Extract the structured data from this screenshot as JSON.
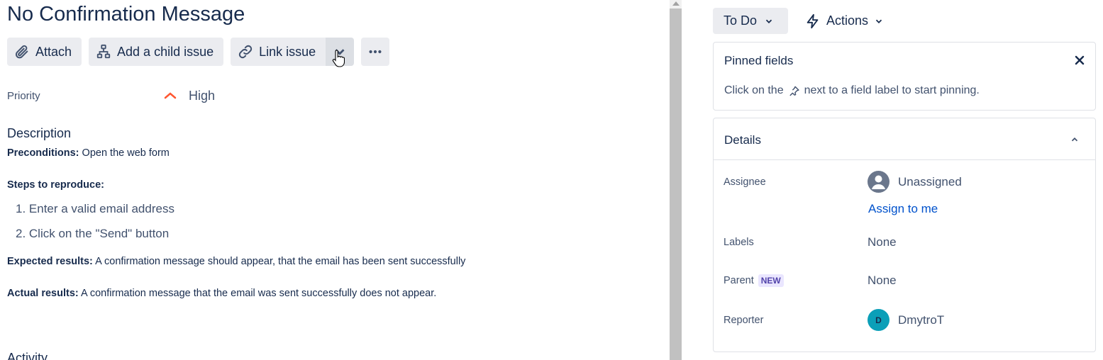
{
  "issue": {
    "title": "No Confirmation Message"
  },
  "toolbar": {
    "attach_label": "Attach",
    "child_label": "Add a child issue",
    "link_label": "Link issue"
  },
  "priority": {
    "label": "Priority",
    "value": "High",
    "icon_color": "#ff5630"
  },
  "description": {
    "heading": "Description",
    "preconditions_label": "Preconditions:",
    "preconditions_text": " Open the web form",
    "steps_label": "Steps to reproduce:",
    "steps": [
      "1. Enter a valid email address",
      "2. Click on the \"Send\" button"
    ],
    "expected_label": "Expected results:",
    "expected_text": " A confirmation message should appear, that the email has been sent successfully",
    "actual_label": "Actual results:",
    "actual_text": " A confirmation message that the email was sent successfully does not appear."
  },
  "activity": {
    "heading": "Activity"
  },
  "status": {
    "label": "To Do"
  },
  "actions": {
    "label": "Actions"
  },
  "pinned": {
    "title": "Pinned fields",
    "text_before": "Click on the",
    "text_after": "next to a field label to start pinning."
  },
  "details": {
    "title": "Details",
    "assignee_label": "Assignee",
    "assignee_value": "Unassigned",
    "assign_to_me": "Assign to me",
    "labels_label": "Labels",
    "labels_value": "None",
    "parent_label": "Parent",
    "parent_badge": "NEW",
    "parent_value": "None",
    "reporter_label": "Reporter",
    "reporter_initial": "D",
    "reporter_value": "DmytroT"
  },
  "colors": {
    "link": "#0052cc",
    "text": "#172b4d",
    "subtle": "#42526e",
    "button_bg": "#ebecf0",
    "reporter_avatar": "#0b9fb8"
  }
}
